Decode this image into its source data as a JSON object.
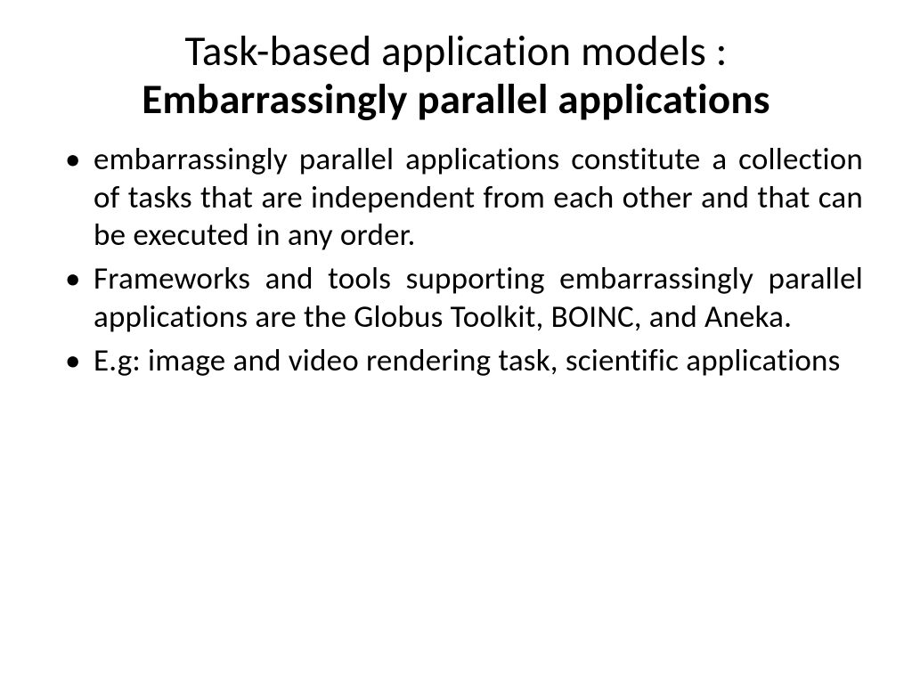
{
  "title": {
    "line1": "Task-based application models :",
    "line2": "Embarrassingly parallel applications"
  },
  "bullets": [
    "embarrassingly parallel applications constitute a collection of tasks that are independent from each other and that can be executed in any order.",
    "Frameworks and tools supporting embarrassingly parallel applications are the Globus Toolkit, BOINC, and Aneka.",
    "E.g:  image and video rendering task, scientific applications"
  ]
}
